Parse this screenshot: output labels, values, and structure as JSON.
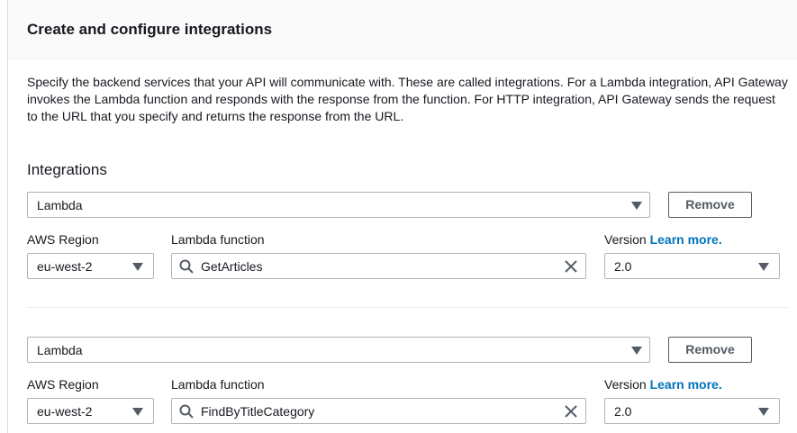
{
  "panel": {
    "title": "Create and configure integrations",
    "description": "Specify the backend services that your API will communicate with. These are called integrations. For a Lambda integration, API Gateway invokes the Lambda function and responds with the response from the function. For HTTP integration, API Gateway sends the request to the URL that you specify and returns the response from the URL.",
    "section_title": "Integrations"
  },
  "integrations": [
    {
      "type": "Lambda",
      "remove_label": "Remove",
      "region_label": "AWS Region",
      "region": "eu-west-2",
      "function_label": "Lambda function",
      "function": "GetArticles",
      "version_label": "Version",
      "learn_more": "Learn more.",
      "version": "2.0"
    },
    {
      "type": "Lambda",
      "remove_label": "Remove",
      "region_label": "AWS Region",
      "region": "eu-west-2",
      "function_label": "Lambda function",
      "function": "FindByTitleCategory",
      "version_label": "Version",
      "learn_more": "Learn more.",
      "version": "2.0"
    }
  ]
}
